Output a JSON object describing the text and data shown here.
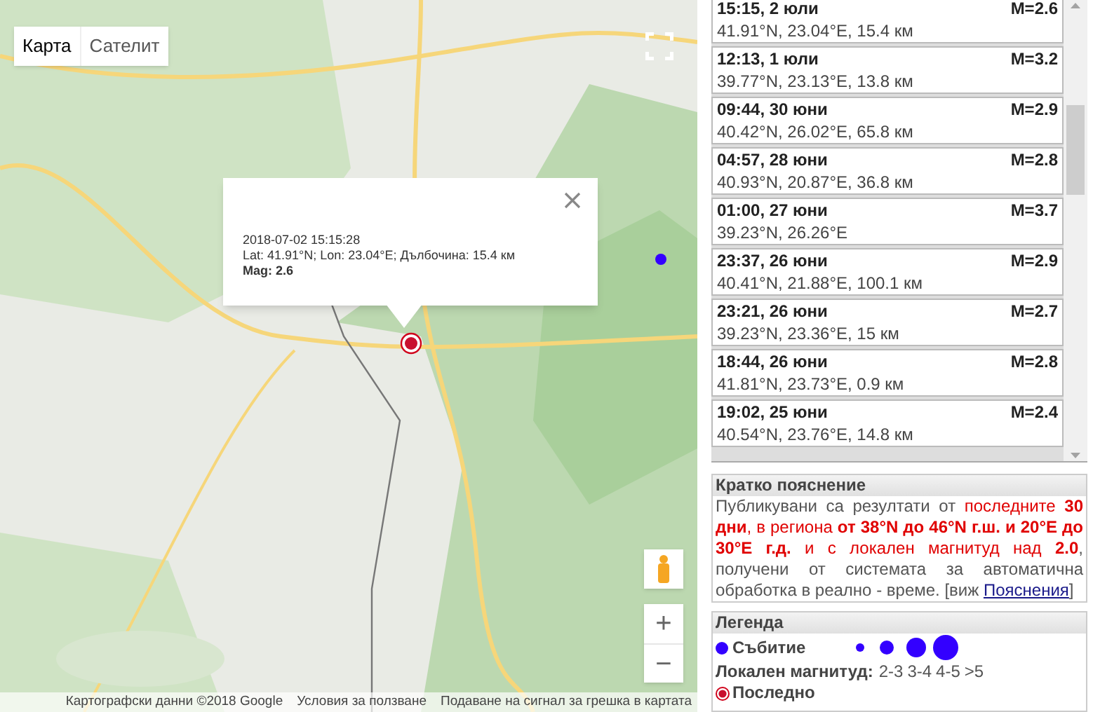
{
  "map": {
    "type_buttons": [
      {
        "label": "Карта",
        "selected": true
      },
      {
        "label": "Сателит",
        "selected": false
      }
    ],
    "info_window": {
      "datetime": "2018-07-02 15:15:28",
      "location": "Lat: 41.91°N; Lon: 23.04°E; Дълбочина: 15.4 км",
      "magnitude": "Mag: 2.6"
    },
    "zoom_in": "+",
    "zoom_out": "−",
    "attribution": [
      "Картографски данни ©2018 Google",
      "Условия за ползване",
      "Подаване на сигнал за грешка в картата"
    ]
  },
  "events": [
    {
      "time": "15:15, 2 юли",
      "magnitude": "M=2.6",
      "details": "41.91°N, 23.04°E, 15.4 км"
    },
    {
      "time": "12:13, 1 юли",
      "magnitude": "M=3.2",
      "details": "39.77°N, 23.13°E, 13.8 км"
    },
    {
      "time": "09:44, 30 юни",
      "magnitude": "M=2.9",
      "details": "40.42°N, 26.02°E, 65.8 км"
    },
    {
      "time": "04:57, 28 юни",
      "magnitude": "M=2.8",
      "details": "40.93°N, 20.87°E, 36.8 км"
    },
    {
      "time": "01:00, 27 юни",
      "magnitude": "M=3.7",
      "details": "39.23°N, 26.26°E"
    },
    {
      "time": "23:37, 26 юни",
      "magnitude": "M=2.9",
      "details": "40.41°N, 21.88°E, 100.1 км"
    },
    {
      "time": "23:21, 26 юни",
      "magnitude": "M=2.7",
      "details": "39.23°N, 23.36°E, 15 км"
    },
    {
      "time": "18:44, 26 юни",
      "magnitude": "M=2.8",
      "details": "41.81°N, 23.73°E, 0.9 км"
    },
    {
      "time": "19:02, 25 юни",
      "magnitude": "M=2.4",
      "details": "40.54°N, 23.76°E, 14.8 км"
    }
  ],
  "summary": {
    "title": "Кратко пояснение",
    "segments": [
      {
        "kind": "plain",
        "text": "Публикувани са резултати от "
      },
      {
        "kind": "red",
        "text": "последните "
      },
      {
        "kind": "red_bold",
        "text": "30 дни"
      },
      {
        "kind": "red",
        "text": ", в региона "
      },
      {
        "kind": "red_bold",
        "text": "от 38°N до 46°N г.ш. и 20°E до 30°E г.д."
      },
      {
        "kind": "red",
        "text": " и с локален магнитуд над "
      },
      {
        "kind": "red_bold",
        "text": "2.0"
      },
      {
        "kind": "plain",
        "text": ", получени от системата за автоматична обработка в реално - време. [виж "
      },
      {
        "kind": "link",
        "text": "Пояснения"
      },
      {
        "kind": "plain",
        "text": "]"
      }
    ]
  },
  "legend": {
    "title": "Легенда",
    "event_label": "Събитие",
    "magnitude_label": "Локален магнитуд:",
    "magnitude_ranges": [
      "2-3",
      "3-4",
      "4-5",
      ">5"
    ],
    "latest_label": "Последно"
  }
}
